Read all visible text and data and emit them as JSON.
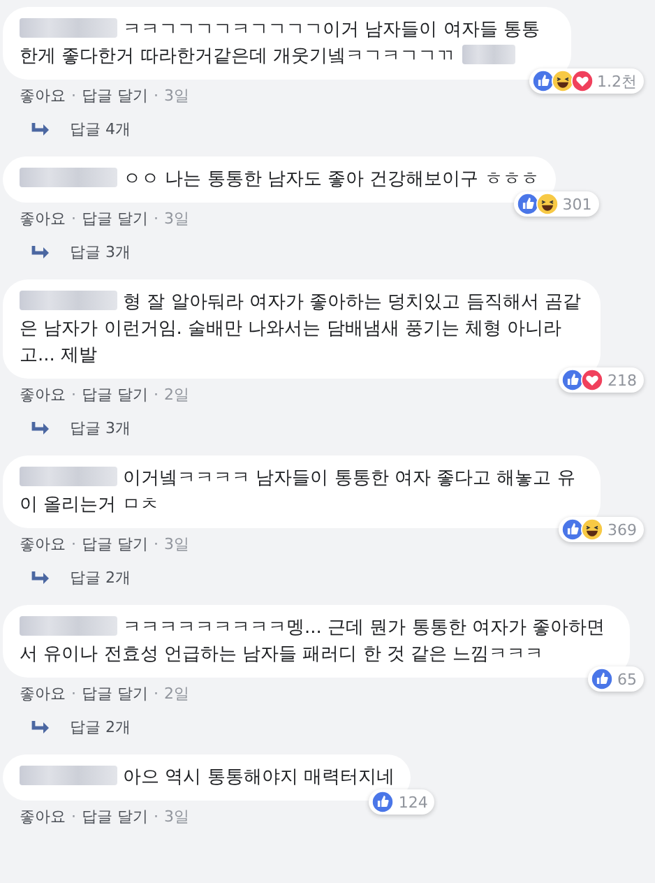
{
  "comments": [
    {
      "text": "ㅋㅋㄱㄱㄱㄱㅋㄱㄱㄱㄱ이거 남자들이 여자들 통통한게 좋다한거 따라한거같은데 개웃기넼ㅋㄱㅋㄱㄱㄲ",
      "tail_blurred": true,
      "reactions": [
        {
          "kind": "like"
        },
        {
          "kind": "haha"
        },
        {
          "kind": "love"
        }
      ],
      "reaction_count": "1.2천",
      "actions": [
        {
          "kind": "link",
          "text": "좋아요"
        },
        {
          "kind": "sep",
          "text": "·"
        },
        {
          "kind": "link",
          "text": "답글 달기"
        },
        {
          "kind": "sep",
          "text": "·"
        },
        {
          "kind": "time",
          "text": "3일"
        }
      ],
      "replies": "답글 4개"
    },
    {
      "text": "ㅇㅇ 나는 통통한 남자도 좋아 건강해보이구 ㅎㅎㅎ",
      "tail_blurred": false,
      "reactions": [
        {
          "kind": "like"
        },
        {
          "kind": "haha"
        }
      ],
      "reaction_count": "301",
      "actions": [
        {
          "kind": "link",
          "text": "좋아요"
        },
        {
          "kind": "sep",
          "text": "·"
        },
        {
          "kind": "link",
          "text": "답글 달기"
        },
        {
          "kind": "sep",
          "text": "·"
        },
        {
          "kind": "time",
          "text": "3일"
        }
      ],
      "replies": "답글 3개"
    },
    {
      "text": "형 잘 알아둬라 여자가 좋아하는 덩치있고 듬직해서 곰같은 남자가 이런거임. 술배만 나와서는 담배냄새 풍기는 체형 아니라고... 제발",
      "tail_blurred": false,
      "reactions": [
        {
          "kind": "like"
        },
        {
          "kind": "love"
        }
      ],
      "reaction_count": "218",
      "actions": [
        {
          "kind": "link",
          "text": "좋아요"
        },
        {
          "kind": "sep",
          "text": "·"
        },
        {
          "kind": "link",
          "text": "답글 달기"
        },
        {
          "kind": "sep",
          "text": "·"
        },
        {
          "kind": "time",
          "text": "2일"
        }
      ],
      "replies": "답글 3개"
    },
    {
      "text": "이거넼ㅋㅋㅋㅋ 남자들이 통통한 여자 좋다고 해놓고 유이 올리는거 ㅁㅊ",
      "tail_blurred": false,
      "reactions": [
        {
          "kind": "like"
        },
        {
          "kind": "haha"
        }
      ],
      "reaction_count": "369",
      "actions": [
        {
          "kind": "link",
          "text": "좋아요"
        },
        {
          "kind": "sep",
          "text": "·"
        },
        {
          "kind": "link",
          "text": "답글 달기"
        },
        {
          "kind": "sep",
          "text": "·"
        },
        {
          "kind": "time",
          "text": "3일"
        }
      ],
      "replies": "답글 2개"
    },
    {
      "text": "ㅋㅋㅋㅋㅋㅋㅋㅋㅋ멩... 근데 뭔가 통통한 여자가 좋아하면서 유이나 전효성 언급하는 남자들 패러디 한 것 같은 느낌ㅋㅋㅋ",
      "tail_blurred": false,
      "reactions": [
        {
          "kind": "like"
        }
      ],
      "reaction_count": "65",
      "actions": [
        {
          "kind": "link",
          "text": "좋아요"
        },
        {
          "kind": "sep",
          "text": "·"
        },
        {
          "kind": "link",
          "text": "답글 달기"
        },
        {
          "kind": "sep",
          "text": "·"
        },
        {
          "kind": "time",
          "text": "2일"
        }
      ],
      "replies": "답글 2개"
    },
    {
      "text": "아으 역시 통통해야지 매력터지네",
      "tail_blurred": false,
      "reactions": [
        {
          "kind": "like"
        }
      ],
      "reaction_count": "124",
      "actions": [
        {
          "kind": "link",
          "text": "좋아요"
        },
        {
          "kind": "sep",
          "text": "·"
        },
        {
          "kind": "link",
          "text": "답글 달기"
        },
        {
          "kind": "sep",
          "text": "·"
        },
        {
          "kind": "time",
          "text": "3일"
        }
      ]
    }
  ]
}
